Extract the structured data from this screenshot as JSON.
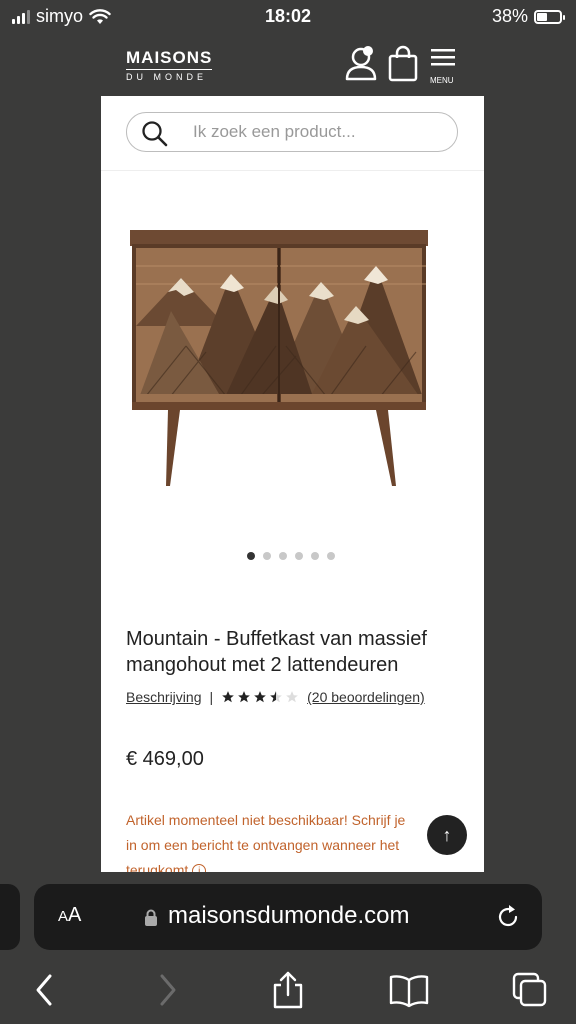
{
  "status_bar": {
    "carrier": "simyo",
    "time": "18:02",
    "battery_percent": "38%",
    "battery_level": 0.38,
    "signal_bars": 3
  },
  "header": {
    "logo_line1": "MAISONS",
    "logo_line2": "DU MONDE",
    "menu_label": "MENU",
    "icons": [
      "account-icon",
      "shopping-bag-icon",
      "hamburger-menu-icon"
    ]
  },
  "search": {
    "placeholder": "Ik zoek een product...",
    "value": ""
  },
  "carousel": {
    "total_slides": 6,
    "active_index": 0
  },
  "product": {
    "title": "Mountain - Buffetkast van massief mangohout met 2 lattendeuren",
    "description_link": "Beschrijving",
    "separator": "|",
    "rating": 3.5,
    "rating_max": 5,
    "reviews_link": "(20 beoordelingen)",
    "price": "€ 469,00",
    "stock_message": "Artikel momenteel niet beschikbaar! Schrijf je in om een bericht te ontvangen wanneer het terugkomt",
    "info_icon_glyph": "i",
    "back_to_top_glyph": "↑"
  },
  "browser": {
    "text_size_label_small": "A",
    "text_size_label_large": "A",
    "url": "maisonsdumonde.com",
    "toolbar_icons": [
      "back-icon",
      "forward-icon",
      "share-icon",
      "bookmarks-icon",
      "tabs-icon"
    ]
  },
  "colors": {
    "background": "#3b3b3a",
    "stock_warning": "#c1632c",
    "url_bar": "#1b1b1b"
  }
}
